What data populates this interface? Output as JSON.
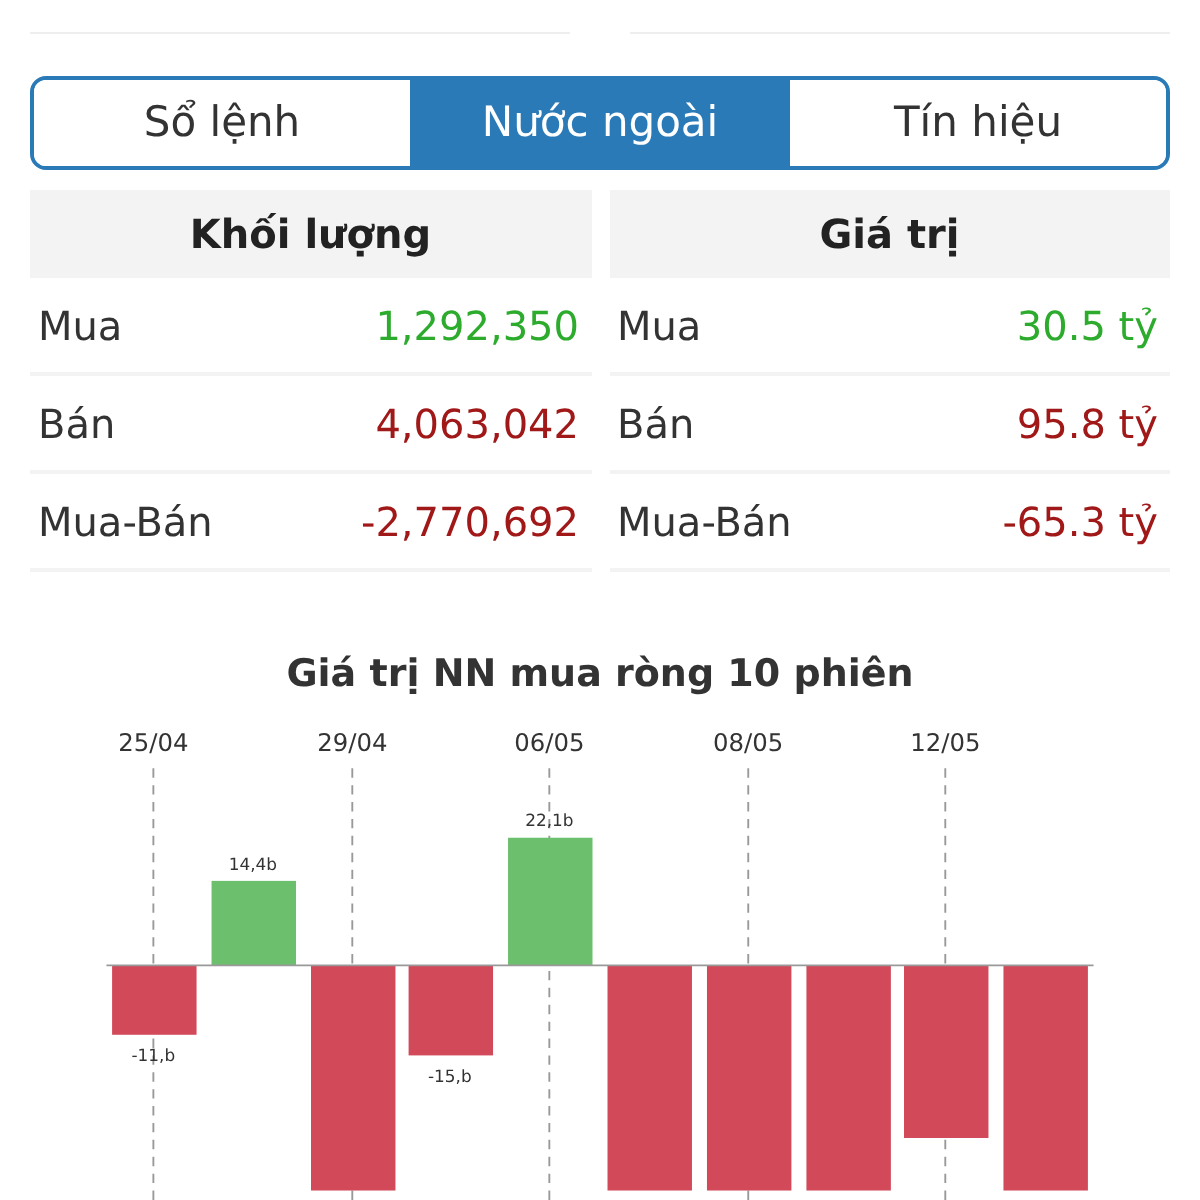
{
  "tabs": [
    {
      "label": "Sổ lệnh",
      "selected": false
    },
    {
      "label": "Nước ngoài",
      "selected": true
    },
    {
      "label": "Tín hiệu",
      "selected": false
    }
  ],
  "tables": [
    {
      "heading": "Khối lượng",
      "rows": [
        {
          "label": "Mua",
          "value": "1,292,350",
          "color": "#2cab2c"
        },
        {
          "label": "Bán",
          "value": "4,063,042",
          "color": "#a01818"
        },
        {
          "label": "Mua-Bán",
          "value": "-2,770,692",
          "color": "#a01818"
        }
      ]
    },
    {
      "heading": "Giá trị",
      "rows": [
        {
          "label": "Mua",
          "value": "30.5 tỷ",
          "color": "#2cab2c"
        },
        {
          "label": "Bán",
          "value": "95.8 tỷ",
          "color": "#a01818"
        },
        {
          "label": "Mua-Bán",
          "value": "-65.3 tỷ",
          "color": "#a01818"
        }
      ]
    }
  ],
  "chart": {
    "title": "Giá trị NN mua ròng 10 phiên",
    "date_labels": [
      "25/04",
      "29/04",
      "06/05",
      "08/05",
      "12/05"
    ],
    "bars": [
      {
        "positive": false,
        "label": "-11,b"
      },
      {
        "positive": true,
        "label": "14,4b"
      },
      {
        "positive": false
      },
      {
        "positive": false,
        "label": "-15,b"
      },
      {
        "positive": true,
        "label": "22,1b"
      },
      {
        "positive": false
      },
      {
        "positive": false
      },
      {
        "positive": false
      },
      {
        "positive": false
      },
      {
        "positive": false
      }
    ]
  }
}
